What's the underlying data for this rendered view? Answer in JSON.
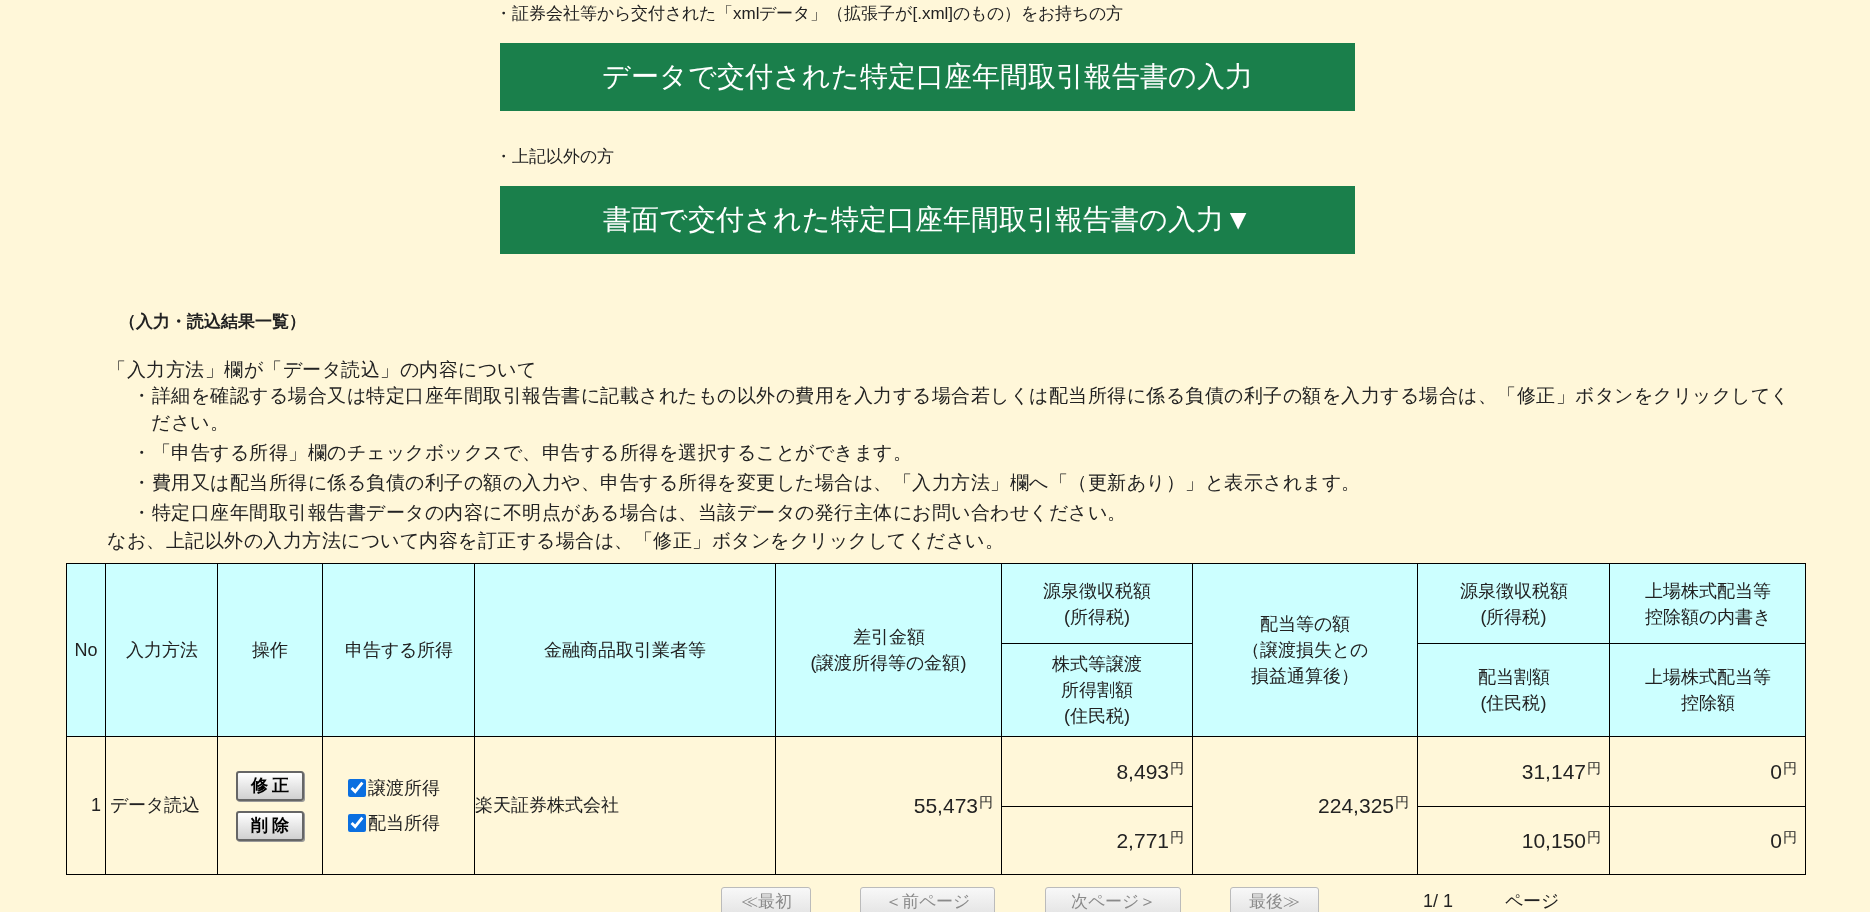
{
  "data_section": {
    "note": "・証券会社等から交付された「xmlデータ」（拡張子が[.xml]のもの）をお持ちの方",
    "button": "データで交付された特定口座年間取引報告書の入力"
  },
  "paper_section": {
    "note": "・上記以外の方",
    "button": "書面で交付された特定口座年間取引報告書の入力▼"
  },
  "results": {
    "heading": "（入力・読込結果一覧）",
    "intro": "「入力方法」欄が「データ読込」の内容について",
    "items": [
      "・詳細を確認する場合又は特定口座年間取引報告書に記載されたもの以外の費用を入力する場合若しくは配当所得に係る負債の利子の額を入力する場合は、「修正」ボタンをクリックしてください。",
      "・「申告する所得」欄のチェックボックスで、申告する所得を選択することができます。",
      "・費用又は配当所得に係る負債の利子の額の入力や、申告する所得を変更した場合は、「入力方法」欄へ「（更新あり）」と表示されます。",
      "・特定口座年間取引報告書データの内容に不明点がある場合は、当該データの発行主体にお問い合わせください。"
    ],
    "footer": "なお、上記以外の入力方法について内容を訂正する場合は、「修正」ボタンをクリックしてください。"
  },
  "table": {
    "columns": [
      {
        "lines": [
          "No"
        ]
      },
      {
        "lines": [
          "入力方法"
        ]
      },
      {
        "lines": [
          "操作"
        ]
      },
      {
        "lines": [
          "申告する所得"
        ]
      },
      {
        "lines": [
          "金融商品取引業者等"
        ]
      },
      {
        "lines": [
          "差引金額",
          "(譲渡所得等の金額)"
        ]
      },
      {
        "lines": [
          "源泉徴収税額",
          "(所得税)"
        ]
      },
      {
        "lines": [
          "配当等の額",
          "（譲渡損失との",
          "損益通算後）"
        ]
      },
      {
        "lines": [
          "源泉徴収税額",
          "(所得税)"
        ]
      },
      {
        "lines": [
          "上場株式配当等",
          "控除額の内書き"
        ]
      }
    ],
    "sub_columns": [
      {
        "lines": [
          "株式等譲渡",
          "所得割額",
          "(住民税)"
        ]
      },
      {
        "lines": [
          "配当割額",
          "(住民税)"
        ]
      },
      {
        "lines": [
          "上場株式配当等",
          "控除額"
        ]
      }
    ],
    "rows": [
      {
        "no": "1",
        "method": "データ読込",
        "actions": [
          "修正",
          "削除"
        ],
        "incomes": [
          {
            "label": "譲渡所得",
            "checked": true
          },
          {
            "label": "配当所得",
            "checked": true
          }
        ],
        "broker": "楽天証券株式会社",
        "net": {
          "amount": "55,473",
          "unit": "円"
        },
        "transfer_income_tax": {
          "amount": "8,493",
          "unit": "円"
        },
        "dividends": {
          "amount": "224,325",
          "unit": "円"
        },
        "dividend_income_tax": {
          "amount": "31,147",
          "unit": "円"
        },
        "listed_dividend_inner": {
          "amount": "0",
          "unit": "円"
        },
        "transfer_resident_tax": {
          "amount": "2,771",
          "unit": "円"
        },
        "dividend_resident_tax": {
          "amount": "10,150",
          "unit": "円"
        },
        "listed_dividend_deduction": {
          "amount": "0",
          "unit": "円"
        }
      }
    ]
  },
  "pagination": {
    "buttons": [
      {
        "label": "≪最初",
        "disabled": true
      },
      {
        "label": "＜前ページ",
        "disabled": true
      },
      {
        "label": "次ページ＞",
        "disabled": true
      },
      {
        "label": "最後≫",
        "disabled": true
      }
    ],
    "page": "1/ 1",
    "suffix": "ページ"
  }
}
